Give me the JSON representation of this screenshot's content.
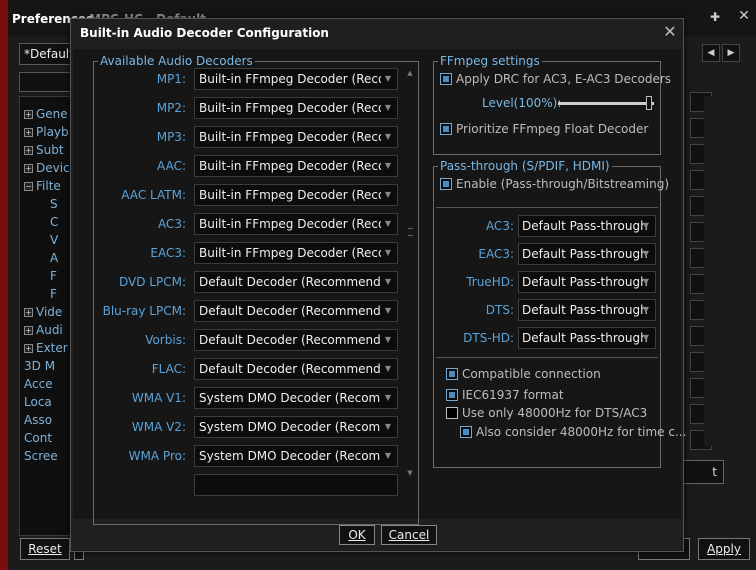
{
  "background_window": {
    "title": "Preferences",
    "title_ghost": "- MPC-HC - Default",
    "preset": "*Default",
    "tree_items": [
      "Gene",
      "Playb",
      "Subt",
      "Devic",
      "Filte",
      "S",
      "C",
      "V",
      "A",
      "F",
      "F",
      "Vide",
      "Audi",
      "Exter",
      "3D M",
      "Acce",
      "Loca",
      "Asso",
      "Cont",
      "Scree"
    ],
    "reset_label": "Reset",
    "apply_label": "Apply",
    "partial_button_label": "t"
  },
  "dialog": {
    "title": "Built-in Audio Decoder Configuration",
    "ok_label": "OK",
    "cancel_label": "Cancel"
  },
  "decoders": {
    "legend": "Available Audio Decoders",
    "rows": [
      {
        "label": "MP1:",
        "value": "Built-in FFmpeg Decoder (Recommended)"
      },
      {
        "label": "MP2:",
        "value": "Built-in FFmpeg Decoder (Recommended)"
      },
      {
        "label": "MP3:",
        "value": "Built-in FFmpeg Decoder (Recommended)"
      },
      {
        "label": "AAC:",
        "value": "Built-in FFmpeg Decoder (Recommended)"
      },
      {
        "label": "AAC LATM:",
        "value": "Built-in FFmpeg Decoder (Recommended)"
      },
      {
        "label": "AC3:",
        "value": "Built-in FFmpeg Decoder (Recommended)"
      },
      {
        "label": "EAC3:",
        "value": "Built-in FFmpeg Decoder (Recommended)"
      },
      {
        "label": "DVD LPCM:",
        "value": "Default Decoder (Recommended)"
      },
      {
        "label": "Blu-ray LPCM:",
        "value": "Default Decoder (Recommended)"
      },
      {
        "label": "Vorbis:",
        "value": "Default Decoder (Recommended)"
      },
      {
        "label": "FLAC:",
        "value": "Default Decoder (Recommended)"
      },
      {
        "label": "WMA V1:",
        "value": "System DMO Decoder (Recommended)"
      },
      {
        "label": "WMA V2:",
        "value": "System DMO Decoder (Recommended)"
      },
      {
        "label": "WMA Pro:",
        "value": "System DMO Decoder (Recommended)"
      }
    ]
  },
  "ffmpeg": {
    "legend": "FFmpeg settings",
    "apply_drc_label": "Apply DRC for AC3, E-AC3 Decoders",
    "apply_drc_checked": true,
    "level_label": "Level(100%):",
    "level_value": 1.0,
    "float_label": "Prioritize FFmpeg Float Decoder",
    "float_checked": true
  },
  "passthrough": {
    "legend": "Pass-through (S/PDIF, HDMI)",
    "enable_label": "Enable (Pass-through/Bitstreaming)",
    "enable_checked": true,
    "rows": [
      {
        "label": "AC3:",
        "value": "Default Pass-through"
      },
      {
        "label": "EAC3:",
        "value": "Default Pass-through"
      },
      {
        "label": "TrueHD:",
        "value": "Default Pass-through"
      },
      {
        "label": "DTS:",
        "value": "Default Pass-through"
      },
      {
        "label": "DTS-HD:",
        "value": "Default Pass-through"
      }
    ],
    "compatible_label": "Compatible connection",
    "compatible_checked": true,
    "iec_label": "IEC61937 format",
    "iec_checked": true,
    "only48k_label": "Use only 48000Hz for DTS/AC3",
    "only48k_checked": false,
    "also48k_label": "Also consider 48000Hz for time c...",
    "also48k_checked": true
  },
  "colors": {
    "label_blue": "#5aa3d8",
    "legend_blue": "#7ab8e4",
    "background": "#161616",
    "accent_red": "#7a0d0d"
  }
}
